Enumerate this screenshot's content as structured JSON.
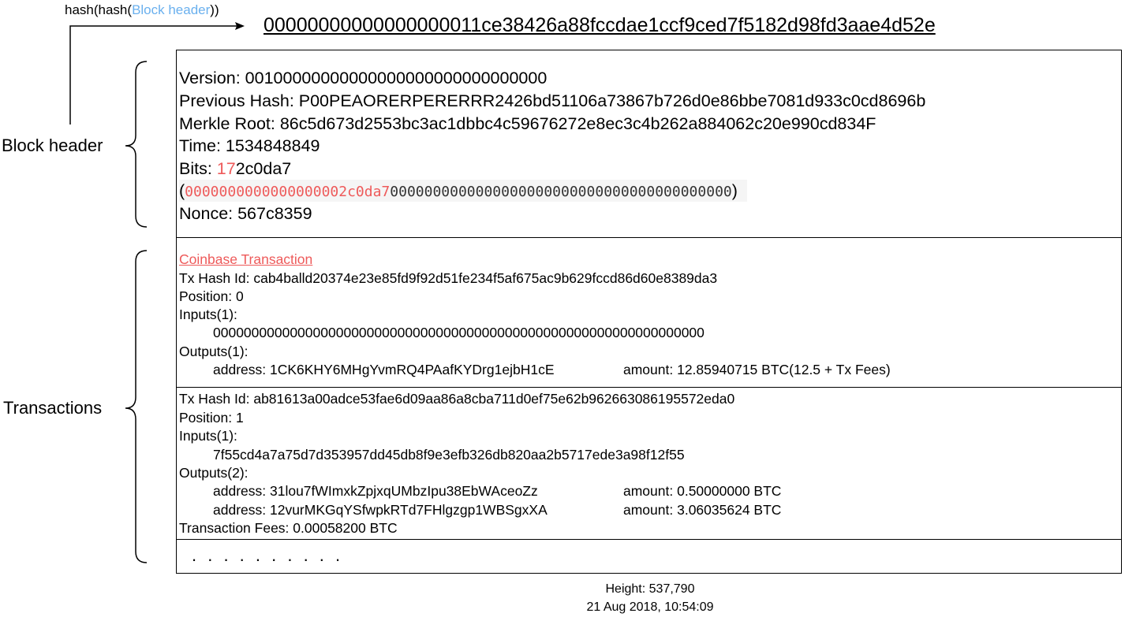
{
  "hash_caption": {
    "prefix": "hash(hash(",
    "highlight": "Block header",
    "suffix": "))"
  },
  "block_hash": "00000000000000000011ce38426a88fccdae1ccf9ced7f5182d98fd3aae4d52e",
  "labels": {
    "block_header": "Block header",
    "transactions": "Transactions"
  },
  "header": {
    "version": "Version: 00100000000000000000000000000000",
    "previous_hash": "Previous Hash: P00PEAORERPERERRR2426bd51106a73867b726d0e86bbe7081d933c0cd8696b",
    "merkle_root": "Merkle Root: 86c5d673d2553bc3ac1dbbc4c59676272e8ec3c4b262a884062c20e990cd834F",
    "time": "Time: 1534848849",
    "bits_prefix": "Bits: ",
    "bits_exponent": "17",
    "bits_mantissa": "2c0da7",
    "target_open": "(",
    "target_highlight": "0000000000000000002c0da7",
    "target_rest": "0000000000000000000000000000000000000000",
    "target_close": ")",
    "nonce": "Nonce: 567c8359"
  },
  "transactions": [
    {
      "title": "Coinbase Transaction",
      "hash": "Tx Hash Id: cab4balld20374e23e85fd9f92d51fe234f5af675ac9b629fccd86d60e8389da3",
      "position": "Position: 0",
      "inputs_label": "Inputs(1):",
      "inputs": [
        "0000000000000000000000000000000000000000000000000000000000000000"
      ],
      "outputs_label": "Outputs(1):",
      "outputs": [
        {
          "address": "address: 1CK6KHY6MHgYvmRQ4PAafKYDrg1ejbH1cE",
          "amount": "amount: 12.85940715 BTC(12.5 + Tx Fees)"
        }
      ]
    },
    {
      "hash": "Tx Hash Id: ab81613a00adce53fae6d09aa86a8cba711d0ef75e62b962663086195572eda0",
      "position": "Position: 1",
      "inputs_label": "Inputs(1):",
      "inputs": [
        "7f55cd4a7a75d7d353957dd45db8f9e3efb326db820aa2b5717ede3a98f12f55"
      ],
      "outputs_label": "Outputs(2):",
      "outputs": [
        {
          "address": "address: 31lou7fWImxkZpjxqUMbzIpu38EbWAceoZz",
          "amount": "amount: 0.50000000 BTC"
        },
        {
          "address": "address: 12vurMKGqYSfwpkRTd7FHlgzgp1WBSgxXA",
          "amount": "amount: 3.06035624 BTC"
        }
      ],
      "fees": "Transaction Fees: 0.00058200 BTC"
    }
  ],
  "ellipsis": ". . . . . . . . . .",
  "footer": {
    "height": "Height: 537,790",
    "datetime": "21 Aug 2018, 10:54:09"
  }
}
